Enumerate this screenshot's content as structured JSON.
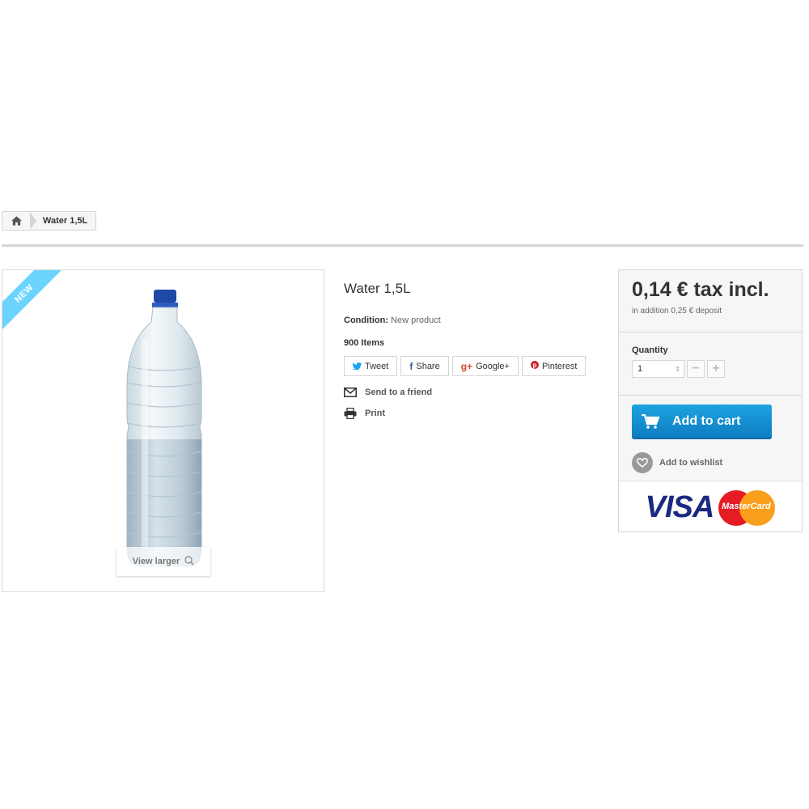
{
  "breadcrumb": {
    "current": "Water 1,5L",
    "home_icon": "home-icon"
  },
  "product": {
    "badge": "NEW",
    "title": "Water 1,5L",
    "condition_label": "Condition:",
    "condition_value": "New product",
    "stock": "900 Items",
    "view_larger": "View larger"
  },
  "social": [
    {
      "label": "Tweet",
      "icon": "twitter-icon"
    },
    {
      "label": "Share",
      "icon": "facebook-icon"
    },
    {
      "label": "Google+",
      "icon": "google-plus-icon"
    },
    {
      "label": "Pinterest",
      "icon": "pinterest-icon"
    }
  ],
  "actions": {
    "send_friend": "Send to a friend",
    "print": "Print"
  },
  "buy": {
    "price": "0,14 € tax incl.",
    "deposit": "in addition 0,25 € deposit",
    "quantity_label": "Quantity",
    "quantity_value": "1",
    "add_to_cart": "Add to cart",
    "add_to_wishlist": "Add to wishlist"
  },
  "payment": {
    "visa": "VISA",
    "mastercard": "MasterCard"
  },
  "colors": {
    "accent": "#0e7dc2",
    "ribbon": "#6ad4ff",
    "border": "#d6d4d4"
  }
}
